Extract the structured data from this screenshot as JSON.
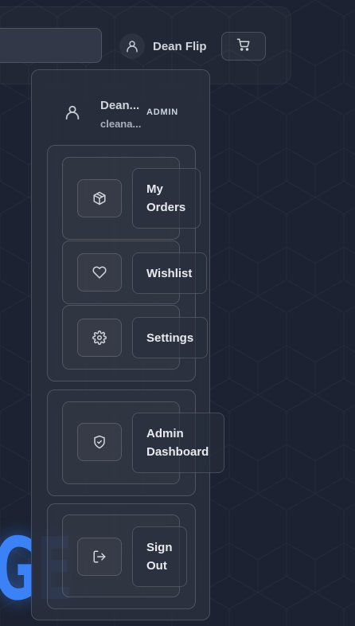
{
  "header": {
    "user_name": "Dean Flip",
    "icons": [
      "user-icon",
      "cart-icon"
    ]
  },
  "hero": {
    "text": "GE"
  },
  "dropdown": {
    "user_name": "Dean...",
    "user_email": "cleana...",
    "role_badge": "ADMIN",
    "items": [
      {
        "label": "My Orders",
        "line1": "My",
        "line2": "Orders",
        "icon": "package-icon"
      },
      {
        "label": "Wishlist",
        "icon": "heart-icon"
      },
      {
        "label": "Settings",
        "icon": "gear-icon"
      },
      {
        "label": "Admin Dashboard",
        "line1": "Admin",
        "line2": "Dashboard",
        "icon": "shield-check-icon"
      },
      {
        "label": "Sign Out",
        "line1": "Sign",
        "line2": "Out",
        "icon": "sign-out-icon"
      }
    ]
  },
  "colors": {
    "background": "#1c2231",
    "accent": "#3b82f6",
    "panel": "#282e3c"
  }
}
